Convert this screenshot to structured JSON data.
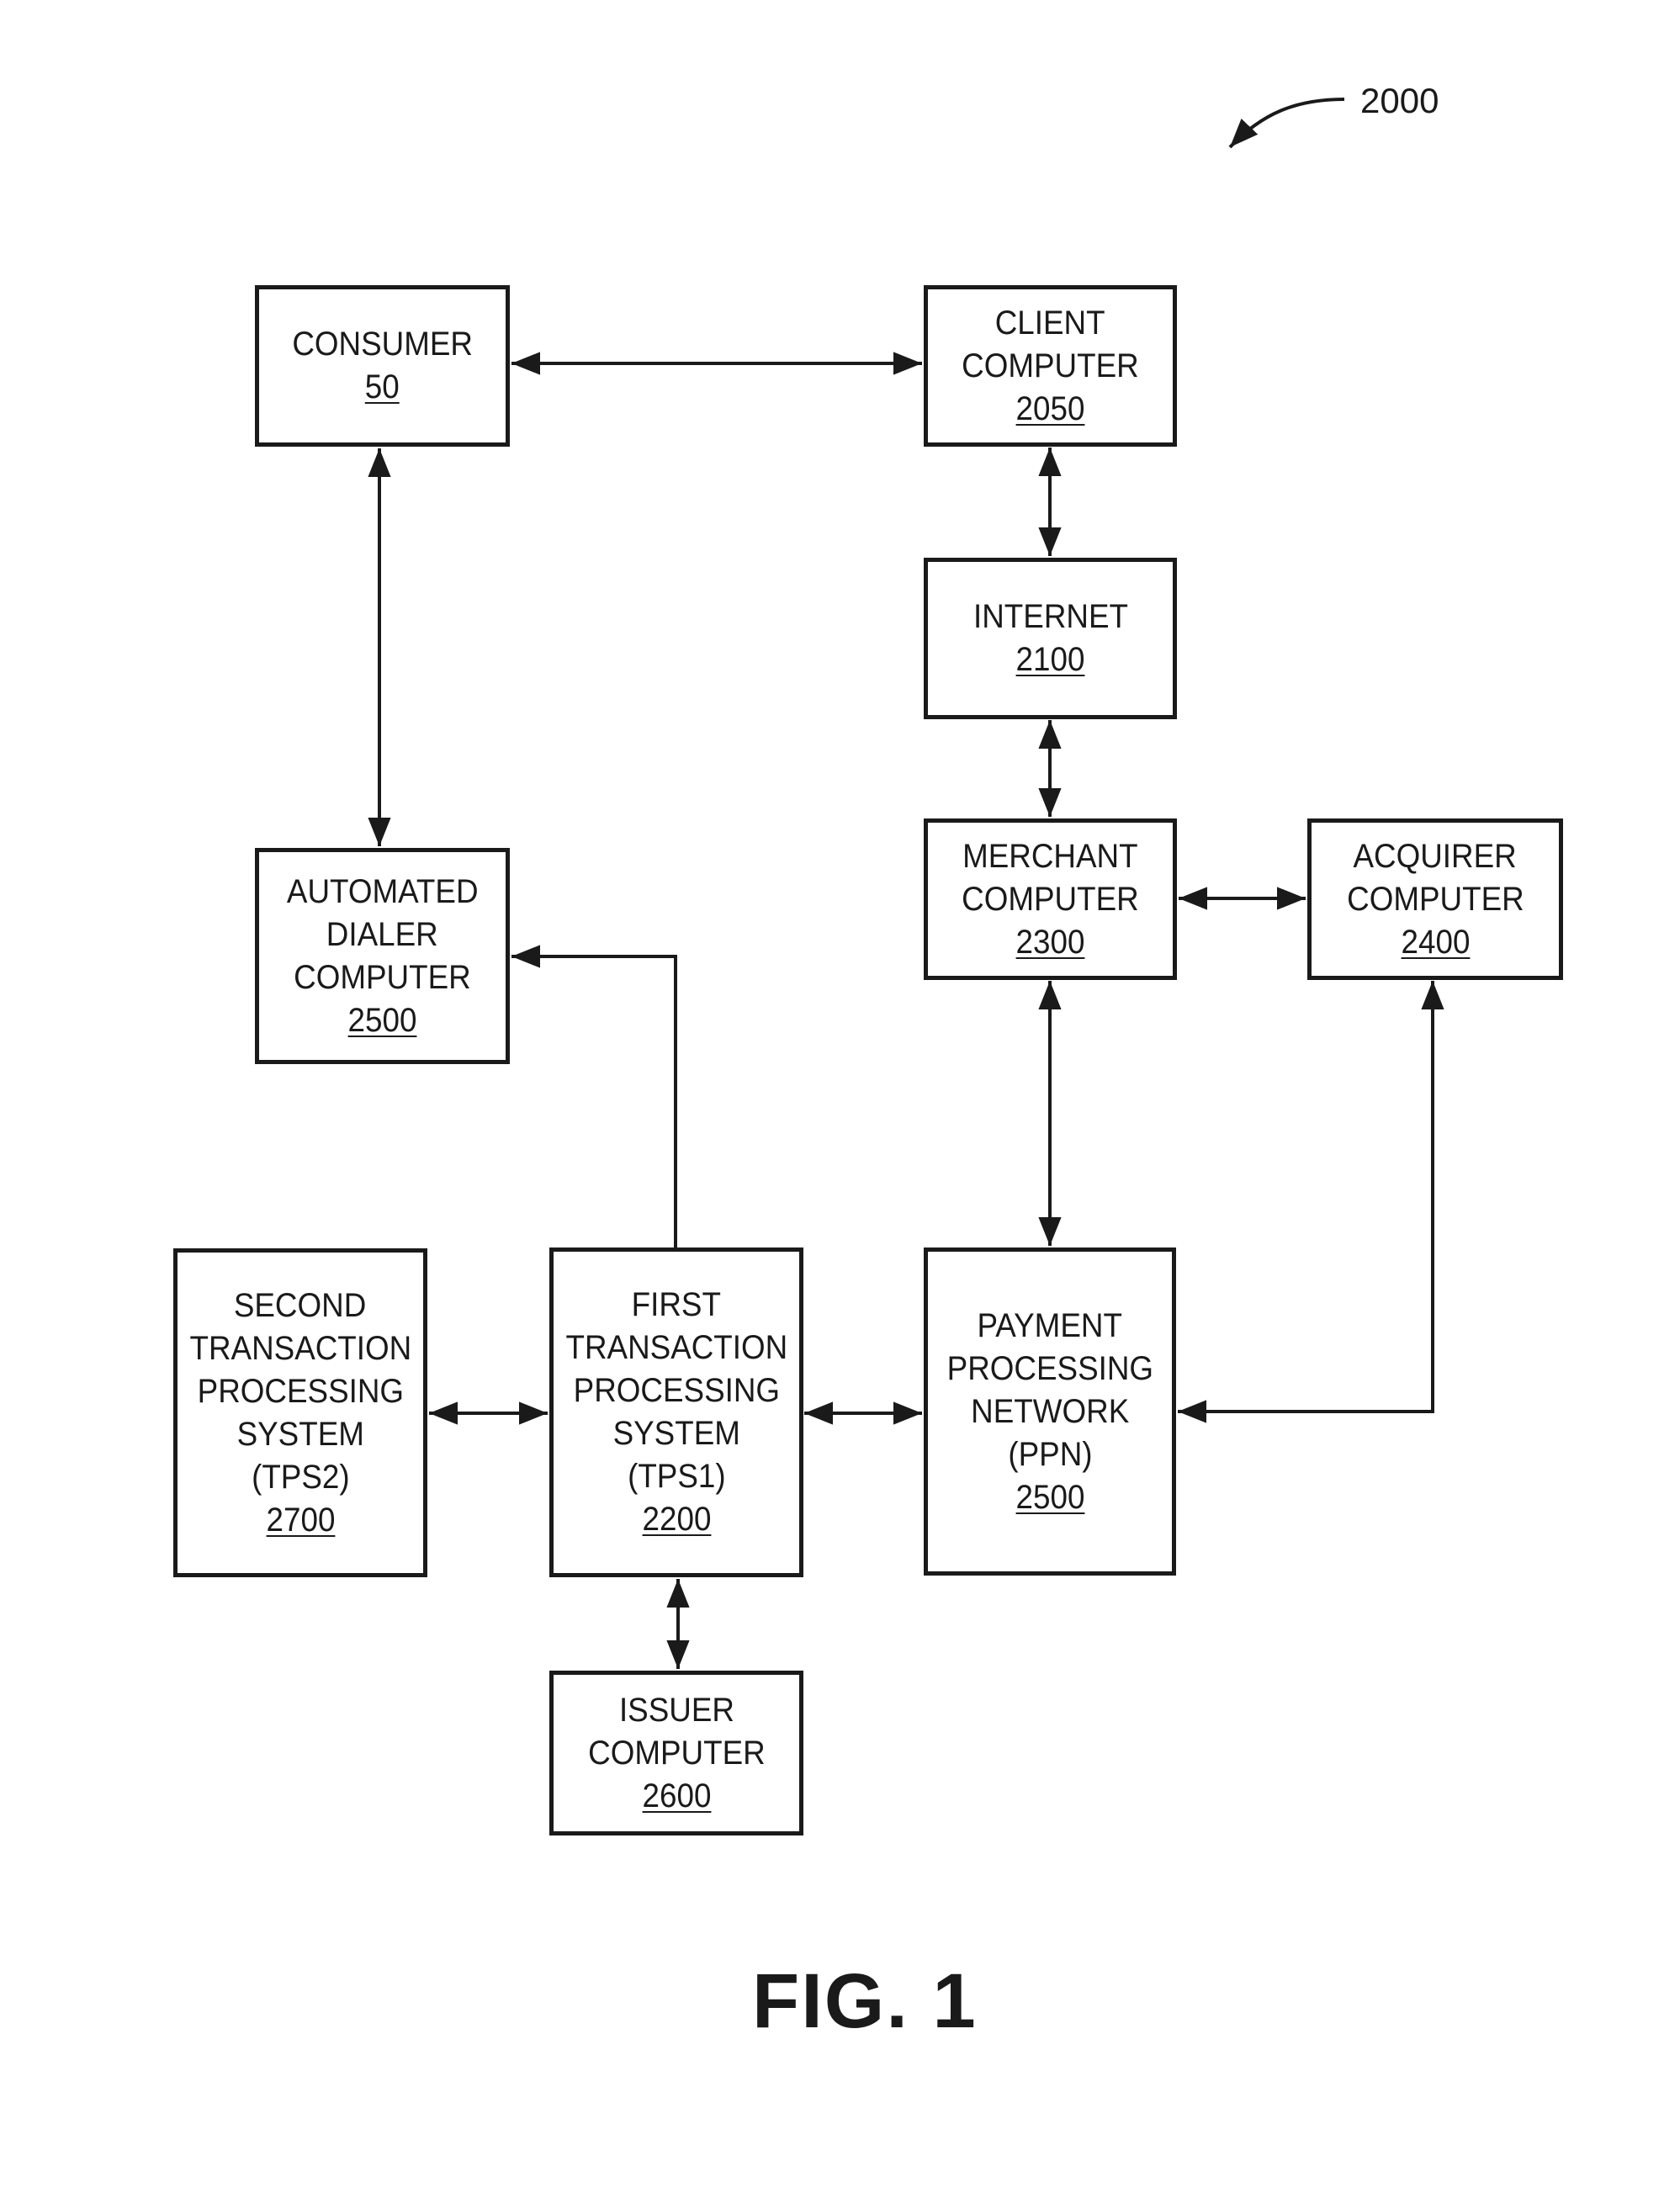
{
  "figure": {
    "reference_number": "2000",
    "title": "FIG. 1"
  },
  "nodes": [
    {
      "id": "consumer",
      "lines": [
        "CONSUMER"
      ],
      "ref": "50"
    },
    {
      "id": "client-computer",
      "lines": [
        "CLIENT",
        "COMPUTER"
      ],
      "ref": "2050"
    },
    {
      "id": "internet",
      "lines": [
        "INTERNET"
      ],
      "ref": "2100"
    },
    {
      "id": "merchant-computer",
      "lines": [
        "MERCHANT",
        "COMPUTER"
      ],
      "ref": "2300"
    },
    {
      "id": "acquirer-computer",
      "lines": [
        "ACQUIRER",
        "COMPUTER"
      ],
      "ref": "2400"
    },
    {
      "id": "automated-dialer-computer",
      "lines": [
        "AUTOMATED",
        "DIALER",
        "COMPUTER"
      ],
      "ref": "2500"
    },
    {
      "id": "second-transaction-processing-system",
      "lines": [
        "SECOND",
        "TRANSACTION",
        "PROCESSING",
        "SYSTEM",
        "(TPS2)"
      ],
      "ref": "2700"
    },
    {
      "id": "first-transaction-processing-system",
      "lines": [
        "FIRST",
        "TRANSACTION",
        "PROCESSING",
        "SYSTEM",
        "(TPS1)"
      ],
      "ref": "2200"
    },
    {
      "id": "payment-processing-network",
      "lines": [
        "PAYMENT",
        "PROCESSING",
        "NETWORK",
        "(PPN)"
      ],
      "ref": "2500"
    },
    {
      "id": "issuer-computer",
      "lines": [
        "ISSUER",
        "COMPUTER"
      ],
      "ref": "2600"
    }
  ],
  "edges": [
    {
      "from": "consumer",
      "to": "client-computer",
      "direction": "both"
    },
    {
      "from": "consumer",
      "to": "automated-dialer-computer",
      "direction": "both"
    },
    {
      "from": "client-computer",
      "to": "internet",
      "direction": "both"
    },
    {
      "from": "internet",
      "to": "merchant-computer",
      "direction": "both"
    },
    {
      "from": "merchant-computer",
      "to": "acquirer-computer",
      "direction": "both"
    },
    {
      "from": "merchant-computer",
      "to": "payment-processing-network",
      "direction": "both"
    },
    {
      "from": "first-transaction-processing-system",
      "to": "automated-dialer-computer",
      "direction": "forward"
    },
    {
      "from": "second-transaction-processing-system",
      "to": "first-transaction-processing-system",
      "direction": "both"
    },
    {
      "from": "first-transaction-processing-system",
      "to": "payment-processing-network",
      "direction": "both"
    },
    {
      "from": "first-transaction-processing-system",
      "to": "issuer-computer",
      "direction": "both"
    },
    {
      "from": "payment-processing-network",
      "to": "acquirer-computer",
      "direction": "both"
    }
  ]
}
